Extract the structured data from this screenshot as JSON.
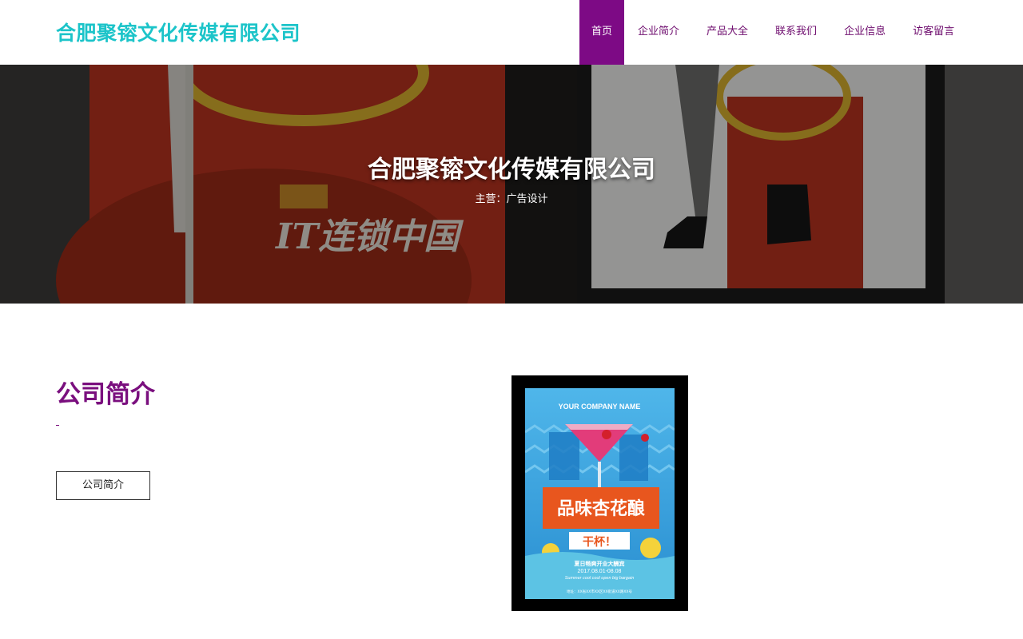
{
  "header": {
    "logo": "合肥聚镕文化传媒有限公司",
    "nav": [
      {
        "label": "首页",
        "active": true
      },
      {
        "label": "企业简介",
        "active": false
      },
      {
        "label": "产品大全",
        "active": false
      },
      {
        "label": "联系我们",
        "active": false
      },
      {
        "label": "企业信息",
        "active": false
      },
      {
        "label": "访客留言",
        "active": false
      }
    ]
  },
  "banner": {
    "title": "合肥聚镕文化传媒有限公司",
    "subtitle": "主营：广告设计",
    "image_text": "IT连锁中国"
  },
  "about": {
    "title": "公司简介",
    "button": "公司简介"
  },
  "poster": {
    "company": "YOUR COMPANY NAME",
    "headline_a": "品味杏花酿",
    "headline_b": "干杯！",
    "promo": "夏日畅爽开业大酬宾",
    "dates": "2017.08.01-08.08",
    "english": "Summer cool cool open big bargain",
    "footer": "地址：XX省XX市XX区XX街道XX路XX号",
    "colors": {
      "background": "#3aa6e0",
      "accent": "#e8561e",
      "glass": "#e23c7a"
    }
  },
  "colors": {
    "brand": "#1cc4c9",
    "accent": "#7d0a85"
  }
}
